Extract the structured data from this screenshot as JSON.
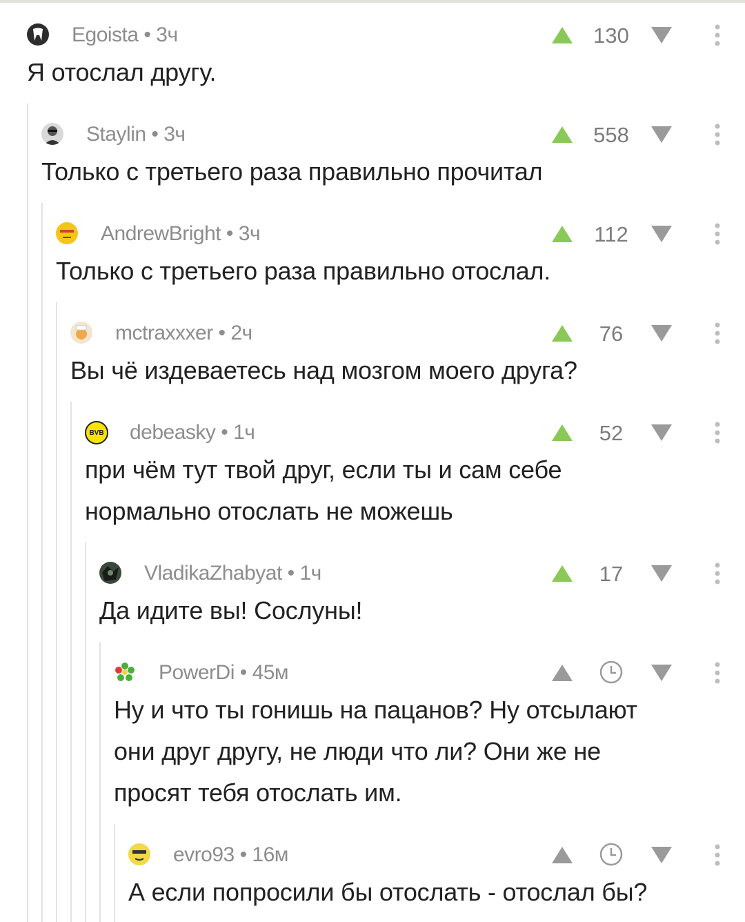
{
  "colors": {
    "up_active": "#8ac858",
    "up_inactive": "#9a9a9a",
    "down": "#9a9a9a",
    "meta": "#8d8d8d",
    "text": "#222222",
    "thread_line": "#e3e3e3"
  },
  "comments": [
    {
      "author": "Egoista",
      "time": "3ч",
      "rating": "130",
      "avatar": "tooth-avatar",
      "text": [
        "Я отослал другу."
      ]
    },
    {
      "author": "Staylin",
      "time": "3ч",
      "rating": "558",
      "avatar": "person-avatar",
      "text": [
        "Только с третьего раза правильно прочитал"
      ]
    },
    {
      "author": "AndrewBright",
      "time": "3ч",
      "rating": "112",
      "avatar": "smiley-avatar",
      "text": [
        "Только с третьего раза правильно отослал."
      ]
    },
    {
      "author": "mctraxxxer",
      "time": "2ч",
      "rating": "76",
      "avatar": "cartoon-avatar",
      "text": [
        "Вы чё издеваетесь над мозгом моего друга?"
      ]
    },
    {
      "author": "debeasky",
      "time": "1ч",
      "rating": "52",
      "avatar": "bvb-logo-avatar",
      "avatar_text": "BVB",
      "text": [
        "при чём тут твой друг, если ты и сам себе",
        "нормально отослать не можешь"
      ]
    },
    {
      "author": "VladikaZhabyat",
      "time": "1ч",
      "rating": "17",
      "avatar": "dark-avatar",
      "text": [
        "Да идите вы! Сослуны!"
      ]
    },
    {
      "author": "PowerDi",
      "time": "45м",
      "rating": null,
      "avatar": "flower-avatar",
      "text": [
        "Ну и что ты гонишь на пацанов? Ну отсылают",
        "они друг другу, не люди что ли? Они же не",
        "просят тебя отослать им."
      ]
    },
    {
      "author": "evro93",
      "time": "16м",
      "rating": null,
      "avatar": "yellow-face-avatar",
      "text": [
        "А если попросили бы отослать - отослал бы?"
      ]
    }
  ]
}
